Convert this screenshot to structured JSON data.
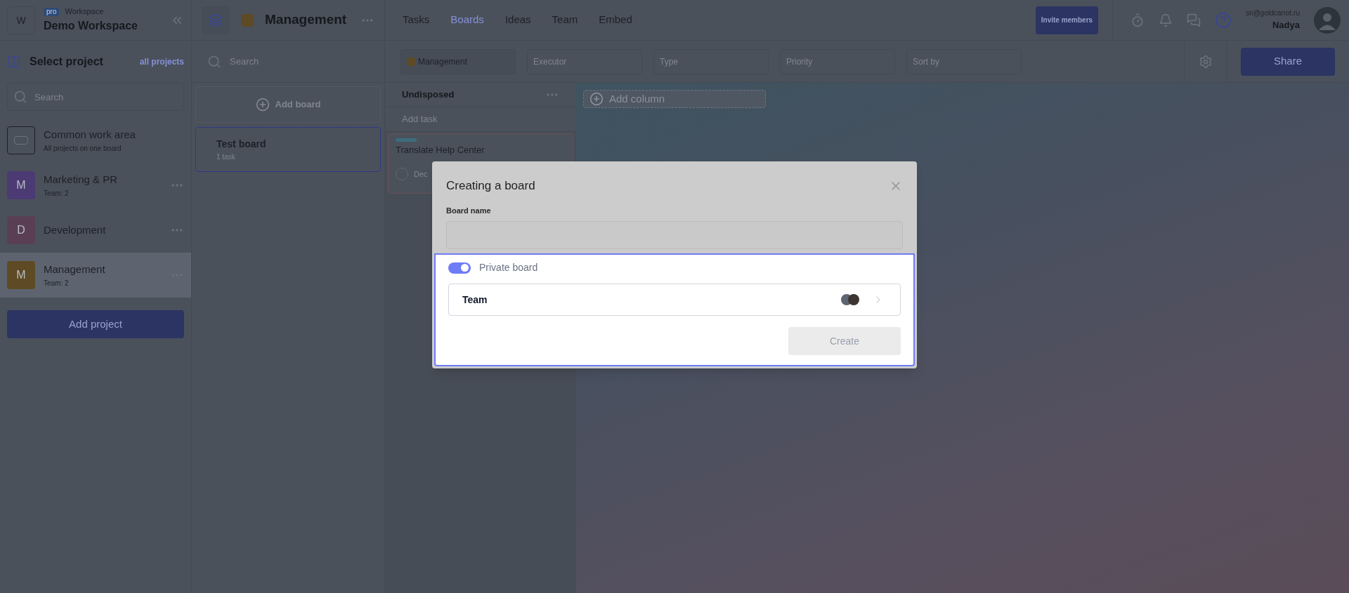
{
  "workspace": {
    "avatar": "W",
    "badge": "pro",
    "label": "Workspace",
    "name": "Demo Workspace"
  },
  "project": {
    "name": "Management",
    "color": "#5e4a24"
  },
  "nav": [
    {
      "label": "Tasks",
      "selected": false
    },
    {
      "label": "Boards",
      "selected": true
    },
    {
      "label": "Ideas",
      "selected": false
    },
    {
      "label": "Team",
      "selected": false
    },
    {
      "label": "Embed",
      "selected": false
    }
  ],
  "invite_button": "Invite members",
  "user": {
    "email": "sn@goldcarrot.ru",
    "name": "Nadya"
  },
  "sidebar": {
    "title": "Select project",
    "link": "all projects",
    "search_placeholder": "Search",
    "projects": [
      {
        "kind": "common",
        "name": "Common work area",
        "subtitle": "All projects on one board",
        "selected": false
      },
      {
        "kind": "letter",
        "avatar": "M",
        "color": "#4b3a74",
        "name": "Marketing & PR",
        "subtitle": "Team: 2",
        "selected": false
      },
      {
        "kind": "letter",
        "avatar": "D",
        "color": "#5a3f54",
        "name": "Development",
        "selected": false
      },
      {
        "kind": "letter",
        "avatar": "M",
        "color": "#5e4a24",
        "name": "Management",
        "subtitle": "Team: 2",
        "selected": true
      }
    ],
    "add_button": "Add project"
  },
  "boards_panel": {
    "search_placeholder": "Search",
    "add_button": "Add board",
    "boards": [
      {
        "name": "Test board",
        "count": "1 task",
        "selected": true
      }
    ]
  },
  "filters": [
    {
      "value": "Management",
      "color": "#5e4a24"
    },
    {
      "placeholder": "Executor"
    },
    {
      "placeholder": "Type"
    },
    {
      "placeholder": "Priority"
    },
    {
      "placeholder": "Sort by"
    }
  ],
  "share_button": "Share",
  "column": {
    "title": "Undisposed",
    "add_task": "Add task",
    "cards": [
      {
        "title": "Translate Help Center",
        "date": "Dec"
      }
    ]
  },
  "add_column": "Add column",
  "modal": {
    "title": "Creating a board",
    "field_label": "Board name",
    "private_toggle": {
      "label": "Private board",
      "on": true
    },
    "team_label": "Team",
    "create_button": "Create"
  }
}
